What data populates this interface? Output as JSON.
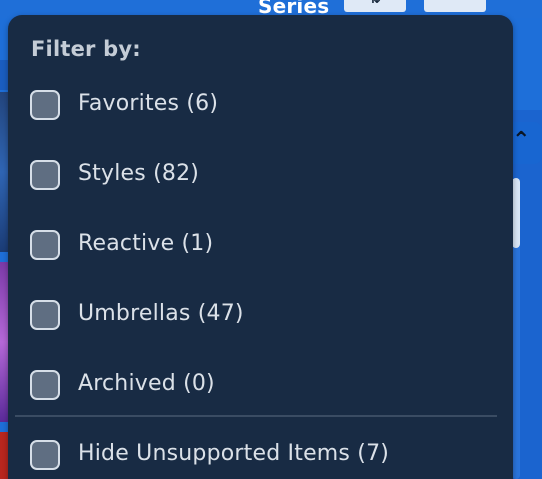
{
  "background": {
    "tab_label": "Series",
    "sort_button_glyph": "⇅",
    "collapse_button_glyph": "−",
    "scroll_up_glyph": "⌃"
  },
  "filter_menu": {
    "title": "Filter by:",
    "options": [
      {
        "label": "Favorites (6)",
        "checked": false
      },
      {
        "label": "Styles (82)",
        "checked": false
      },
      {
        "label": "Reactive (1)",
        "checked": false
      },
      {
        "label": "Umbrellas (47)",
        "checked": false
      },
      {
        "label": "Archived (0)",
        "checked": false
      }
    ],
    "extra_options": [
      {
        "label": "Hide Unsupported Items (7)",
        "checked": false
      }
    ]
  },
  "colors": {
    "panel_bg": "#182b44",
    "checkbox_fill": "#5f6e82",
    "accent_blue": "#1e6fd9"
  }
}
